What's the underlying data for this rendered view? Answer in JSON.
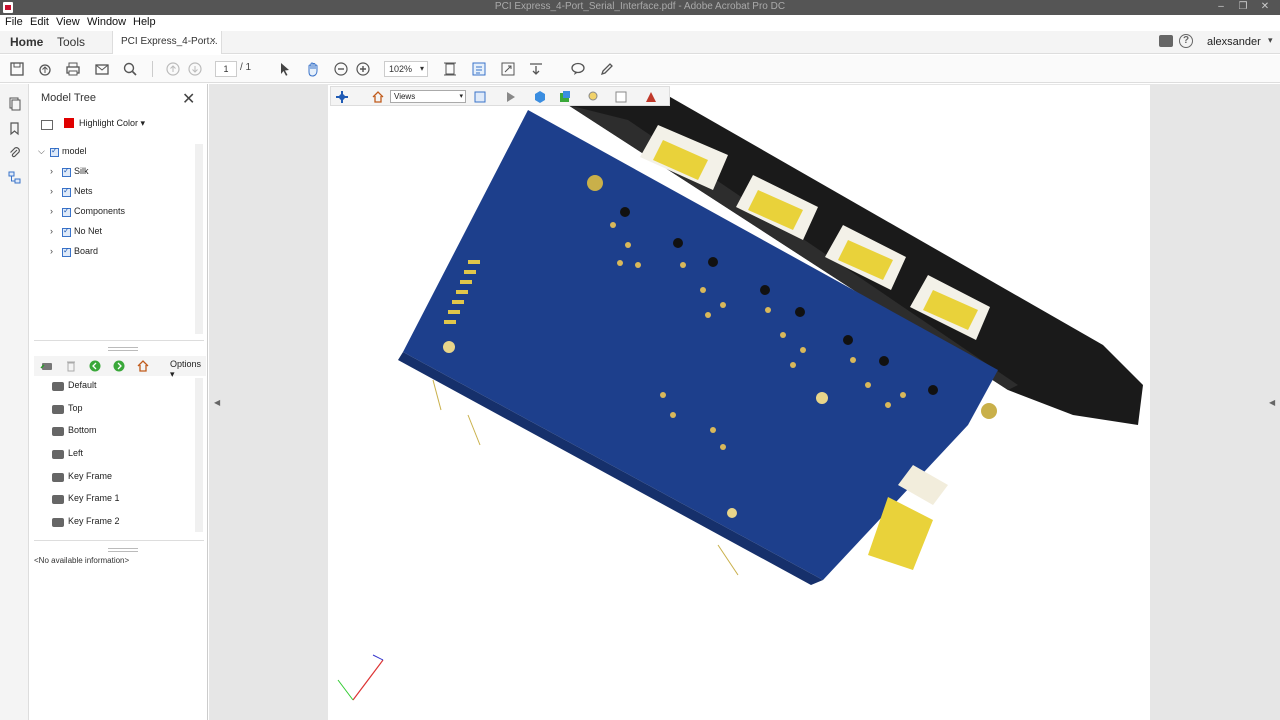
{
  "window": {
    "title": "PCI Express_4-Port_Serial_Interface.pdf - Adobe Acrobat Pro DC",
    "minimize": "–",
    "restore": "❐",
    "close": "✕"
  },
  "menu": [
    "File",
    "Edit",
    "View",
    "Window",
    "Help"
  ],
  "nav": {
    "home": "Home",
    "tools": "Tools",
    "doc_tab": "PCI Express_4-Port...",
    "doc_tab_close": "×",
    "user": "alexsander",
    "help_glyph": "?"
  },
  "toolbar": {
    "page_current": "1",
    "page_total": "/ 1",
    "zoom": "102%"
  },
  "model_tree": {
    "title": "Model Tree",
    "highlight_label": "Highlight Color",
    "highlight_color": "#e00000",
    "nodes": [
      {
        "label": "model"
      },
      {
        "label": "Silk"
      },
      {
        "label": "Nets"
      },
      {
        "label": "Components"
      },
      {
        "label": "No Net"
      },
      {
        "label": "Board"
      }
    ]
  },
  "views_panel": {
    "options_label": "Options",
    "items": [
      "Default",
      "Top",
      "Bottom",
      "Left",
      "Key Frame",
      "Key Frame 1",
      "Key Frame 2"
    ],
    "info": "<No available information>"
  },
  "toolbar_3d": {
    "views_label": "Views"
  },
  "colors": {
    "board_blue": "#1d3f8c",
    "bracket": "#1a1a1a",
    "connector_gold": "#e9d23a"
  }
}
